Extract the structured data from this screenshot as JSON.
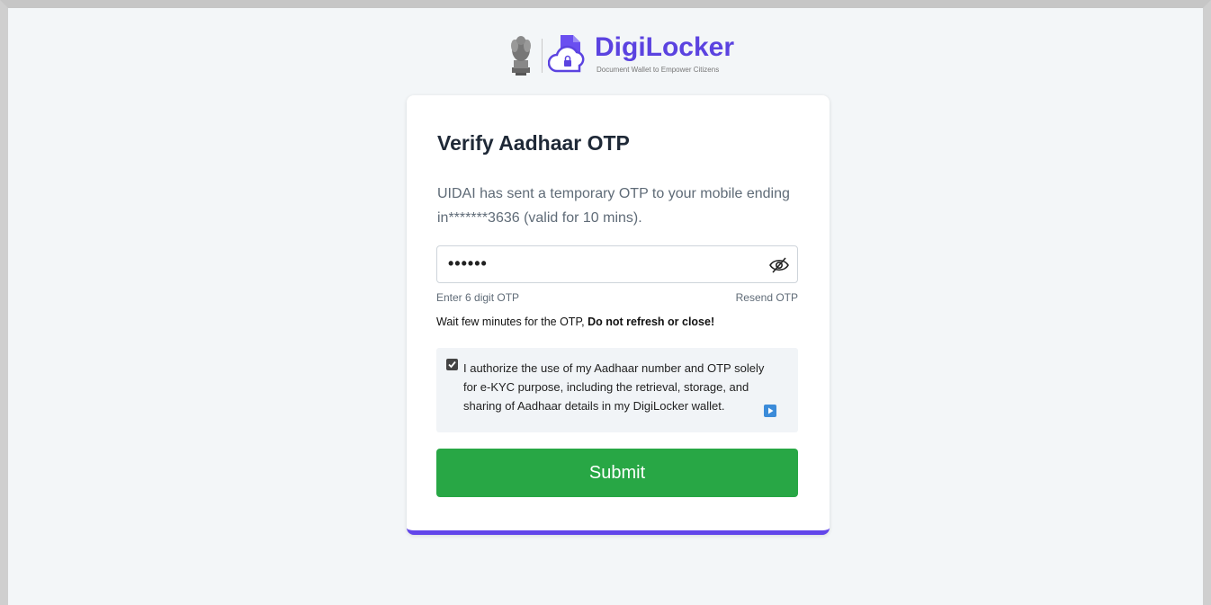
{
  "header": {
    "brand_name": "DigiLocker",
    "tagline": "Document Wallet to Empower Citizens",
    "icons": [
      "national-emblem-icon",
      "digilocker-cloud-icon"
    ]
  },
  "card": {
    "title": "Verify Aadhaar OTP",
    "description": "UIDAI has sent a temporary OTP to your mobile ending in*******3636 (valid for 10 mins).",
    "otp_field": {
      "value": "••••••",
      "icon": "eye-slash-icon"
    },
    "otp_hint": "Enter 6 digit OTP",
    "resend_label": "Resend OTP",
    "wait_text": "Wait few minutes for the OTP, ",
    "wait_emphasis": "Do not refresh or close!",
    "consent": {
      "checked": true,
      "line1": "I authorize the use of my Aadhaar number and OTP solely",
      "line2": "for e-KYC purpose, including the retrieval, storage, and",
      "line3": "sharing of Aadhaar details in my DigiLocker wallet.",
      "icon": "audio-play-icon"
    },
    "submit_label": "Submit"
  },
  "colors": {
    "brand": "#5b43e0",
    "card_accent": "#6246ea",
    "submit": "#28a745",
    "background": "#f3f6f8"
  }
}
